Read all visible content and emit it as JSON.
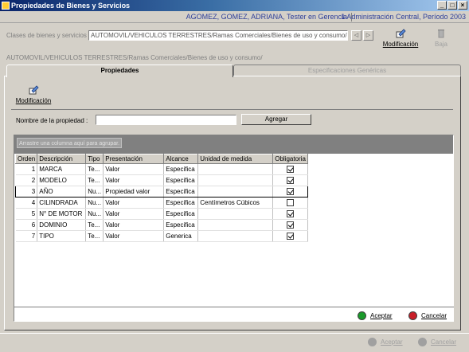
{
  "window": {
    "title": "Propiedades de Bienes y Servicios",
    "controls": [
      "_",
      "□",
      "×"
    ]
  },
  "userbar": {
    "user": "AGOMEZ, GOMEZ, ADRIANA, Tester en Gerencia",
    "org": "1 Administración Central, Período 2003"
  },
  "class_row": {
    "label": "Clases de bienes y servicios",
    "value": "AUTOMOVIL/VEHICULOS TERRESTRES/Ramas Comerciales/Bienes de uso y consumo/",
    "btn_prev": "◁",
    "btn_next": "▷",
    "modify_label": "Modificación",
    "delete_label": "Baja"
  },
  "path": "AUTOMOVIL/VEHICULOS TERRESTRES/Ramas Comerciales/Bienes de uso y consumo/",
  "tabs": {
    "active": "Propiedades",
    "inactive": "Especificaciones Genéricas"
  },
  "toolbar": {
    "modify_label": "Modificación"
  },
  "form": {
    "property_label": "Nombre de la propiedad :",
    "property_value": "",
    "add_label": "Agregar"
  },
  "grid": {
    "group_hint": "Arrastre una columna aquí para agrupar.",
    "columns": [
      "Orden",
      "Descripción",
      "Tipo",
      "Presentación",
      "Alcance",
      "Unidad de medida",
      "Obligatoria"
    ],
    "rows": [
      {
        "orden": "1",
        "desc": "MARCA",
        "tipo": "Te...",
        "pres": "Valor",
        "alc": "Especifica",
        "unidad": "",
        "oblig": true
      },
      {
        "orden": "2",
        "desc": "MODELO",
        "tipo": "Te...",
        "pres": "Valor",
        "alc": "Especifica",
        "unidad": "",
        "oblig": true
      },
      {
        "orden": "3",
        "desc": "AÑO",
        "tipo": "Nu...",
        "pres": "Propiedad valor",
        "alc": "Especifica",
        "unidad": "",
        "oblig": true
      },
      {
        "orden": "4",
        "desc": "CILINDRADA",
        "tipo": "Nu...",
        "pres": "Valor",
        "alc": "Especifica",
        "unidad": "Centímetros Cúbicos",
        "oblig": false
      },
      {
        "orden": "5",
        "desc": "N° DE MOTOR",
        "tipo": "Nu...",
        "pres": "Valor",
        "alc": "Especifica",
        "unidad": "",
        "oblig": true
      },
      {
        "orden": "6",
        "desc": "DOMINIO",
        "tipo": "Te...",
        "pres": "Valor",
        "alc": "Especifica",
        "unidad": "",
        "oblig": true
      },
      {
        "orden": "7",
        "desc": "TIPO",
        "tipo": "Te...",
        "pres": "Valor",
        "alc": "Generica",
        "unidad": "",
        "oblig": true
      }
    ]
  },
  "actions": {
    "accept": "Aceptar",
    "cancel": "Cancelar"
  },
  "bottom": {
    "accept": "Aceptar",
    "cancel": "Cancelar"
  },
  "colors": {
    "accept": "#1a9a2a",
    "cancel": "#c81e28",
    "disabled": "#a0a0a0"
  }
}
